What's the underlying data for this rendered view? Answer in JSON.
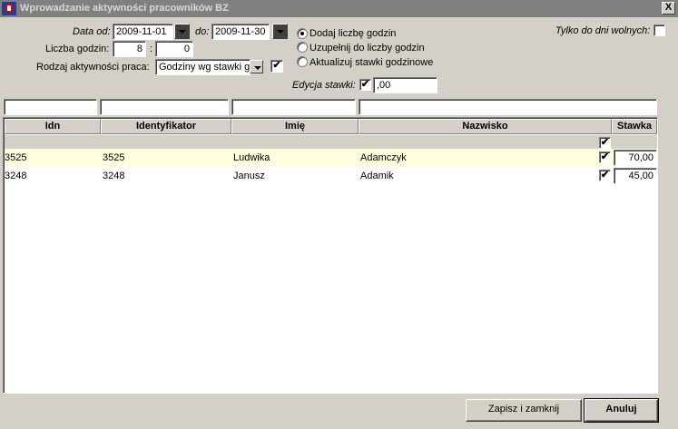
{
  "window": {
    "title": "Wprowadzanie aktywności pracowników BZ",
    "close_glyph": "X"
  },
  "form": {
    "date_from_label": "Data od:",
    "date_from_value": "2009-11-01",
    "date_to_label": "do:",
    "date_to_value": "2009-11-30",
    "hours_label": "Liczba godzin:",
    "hours_value": "8",
    "hours_sep": ":",
    "minutes_value": "0",
    "activity_label": "Rodzaj aktywności praca:",
    "activity_value": "Godziny wg stawki g",
    "activity_checked": true,
    "radio_options": [
      {
        "label": "Dodaj liczbę godzin",
        "selected": true
      },
      {
        "label": "Uzupełnij do liczby godzin",
        "selected": false
      },
      {
        "label": "Aktualizuj stawki godzinowe",
        "selected": false
      }
    ],
    "rate_edit_label": "Edycja stawki:",
    "rate_edit_checked": true,
    "rate_edit_value": ",00",
    "days_off_label": "Tylko do dni wolnych:",
    "days_off_checked": false
  },
  "table": {
    "filters": [
      "",
      "",
      "",
      ""
    ],
    "columns": [
      "Idn",
      "Identyfikator",
      "Imię",
      "Nazwisko",
      "Stawka"
    ],
    "header_checkbox_checked": true,
    "rows": [
      {
        "idn": "3525",
        "identifier": "3525",
        "first_name": "Ludwika",
        "last_name": "Adamczyk",
        "checked": true,
        "rate": "70,00"
      },
      {
        "idn": "3248",
        "identifier": "3248",
        "first_name": "Janusz",
        "last_name": "Adamik",
        "checked": true,
        "rate": "45,00"
      }
    ]
  },
  "buttons": {
    "save_close": "Zapisz i zamknij",
    "cancel": "Anuluj"
  },
  "colors": {
    "selected_row": "#ffffe0",
    "title_bar": "#808080"
  }
}
